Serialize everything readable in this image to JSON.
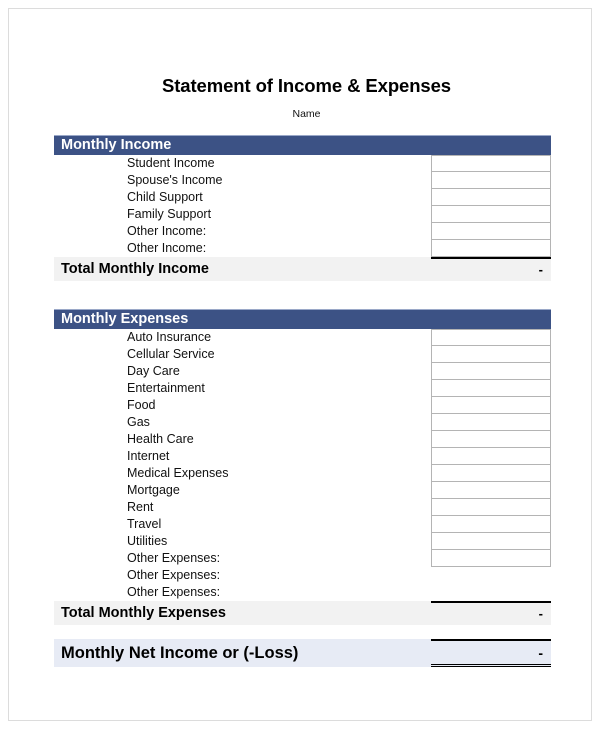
{
  "document": {
    "title": "Statement of Income & Expenses",
    "subtitle": "Name"
  },
  "colors": {
    "header_bar": "#3c5285",
    "header_text": "#ffffff",
    "total_row_bg": "#f2f2f2",
    "net_row_bg": "#e7ebf5",
    "input_border": "#b4b4b4",
    "page_border": "#dcdcdc"
  },
  "income": {
    "header": "Monthly Income",
    "items": [
      {
        "label": "Student Income",
        "value": "",
        "has_input": true
      },
      {
        "label": "Spouse's Income",
        "value": "",
        "has_input": true
      },
      {
        "label": "Child Support",
        "value": "",
        "has_input": true
      },
      {
        "label": "Family Support",
        "value": "",
        "has_input": true
      },
      {
        "label": "Other Income:",
        "value": "",
        "has_input": true
      },
      {
        "label": "Other Income:",
        "value": "",
        "has_input": true
      }
    ],
    "total_label": "Total Monthly Income",
    "total_value": "-"
  },
  "expenses": {
    "header": "Monthly Expenses",
    "items": [
      {
        "label": "Auto Insurance",
        "value": "",
        "has_input": true
      },
      {
        "label": "Cellular Service",
        "value": "",
        "has_input": true
      },
      {
        "label": "Day Care",
        "value": "",
        "has_input": true
      },
      {
        "label": "Entertainment",
        "value": "",
        "has_input": true
      },
      {
        "label": "Food",
        "value": "",
        "has_input": true
      },
      {
        "label": "Gas",
        "value": "",
        "has_input": true
      },
      {
        "label": "Health Care",
        "value": "",
        "has_input": true
      },
      {
        "label": "Internet",
        "value": "",
        "has_input": true
      },
      {
        "label": "Medical Expenses",
        "value": "",
        "has_input": true
      },
      {
        "label": "Mortgage",
        "value": "",
        "has_input": true
      },
      {
        "label": "Rent",
        "value": "",
        "has_input": true
      },
      {
        "label": "Travel",
        "value": "",
        "has_input": true
      },
      {
        "label": "Utilities",
        "value": "",
        "has_input": true
      },
      {
        "label": "Other Expenses:",
        "value": "",
        "has_input": true
      },
      {
        "label": "Other Expenses:",
        "value": "",
        "has_input": false
      },
      {
        "label": "Other Expenses:",
        "value": "",
        "has_input": false
      }
    ],
    "total_label": "Total Monthly Expenses",
    "total_value": "-"
  },
  "net": {
    "label": "Monthly Net Income or (-Loss)",
    "value": "-"
  }
}
